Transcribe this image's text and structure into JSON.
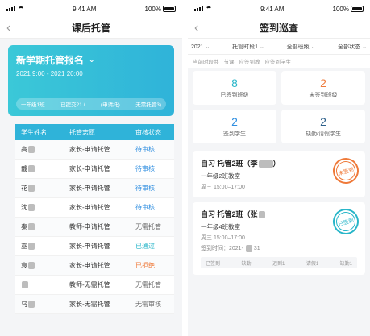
{
  "status": {
    "time": "9:41 AM",
    "battery": "100%"
  },
  "left": {
    "title": "课后托管",
    "banner": {
      "title": "新学期托管报名",
      "time": "2021     9:00 - 2021         20:00",
      "chips": [
        "一年级1班",
        "已提交21 /",
        "(申请托)",
        "无需托管3)"
      ]
    },
    "table": {
      "headers": [
        "学生姓名",
        "托管志愿",
        "审核状态"
      ],
      "rows": [
        {
          "name": "高",
          "wish": "家长-申请托管",
          "status": "待审核",
          "kind": "pending"
        },
        {
          "name": "戴",
          "wish": "家长-申请托管",
          "status": "待审核",
          "kind": "pending"
        },
        {
          "name": "花",
          "wish": "家长-申请托管",
          "status": "待审核",
          "kind": "pending"
        },
        {
          "name": "沈",
          "wish": "家长-申请托管",
          "status": "待审核",
          "kind": "pending"
        },
        {
          "name": "秦",
          "wish": "教师-申请托管",
          "status": "无需托管",
          "kind": "none"
        },
        {
          "name": "巫",
          "wish": "家长-申请托管",
          "status": "已通过",
          "kind": "pass"
        },
        {
          "name": "袁",
          "wish": "家长-申请托管",
          "status": "已拒绝",
          "kind": "reject"
        },
        {
          "name": "",
          "wish": "教师-无需托管",
          "status": "无需托管",
          "kind": "none"
        },
        {
          "name": "乌",
          "wish": "家长-无需托管",
          "status": "无需审核",
          "kind": "none"
        }
      ]
    }
  },
  "right": {
    "title": "签到巡查",
    "filters": [
      "2021",
      "托管时段1",
      "全部班级",
      "全部状态"
    ],
    "info": [
      "当前时段共",
      "节课",
      "应签到教",
      "应签到学生"
    ],
    "stats": [
      {
        "num": "8",
        "label": "已签到班级",
        "color": "n-cyan"
      },
      {
        "num": "2",
        "label": "未签到班级",
        "color": "n-orange"
      },
      {
        "num": "2",
        "label": "签到学生",
        "color": "n-blue"
      },
      {
        "num": "2",
        "label": "缺勤/请假学生",
        "color": "n-navy"
      }
    ],
    "cards": [
      {
        "title": "自习  托管2班（李",
        "location": "一年级2班教室",
        "time": "周三  15:00–17:00",
        "seal": "未签到"
      },
      {
        "title": "自习  托管2班（张",
        "location": "一年级4班教室",
        "time": "周三  15:00–17:00",
        "signed": "签到时间：2021-",
        "signed_tail": "31",
        "seal": "已签到",
        "counts": [
          "已签到",
          "缺勤",
          "迟到1",
          "请假1",
          "缺勤1"
        ]
      }
    ]
  }
}
